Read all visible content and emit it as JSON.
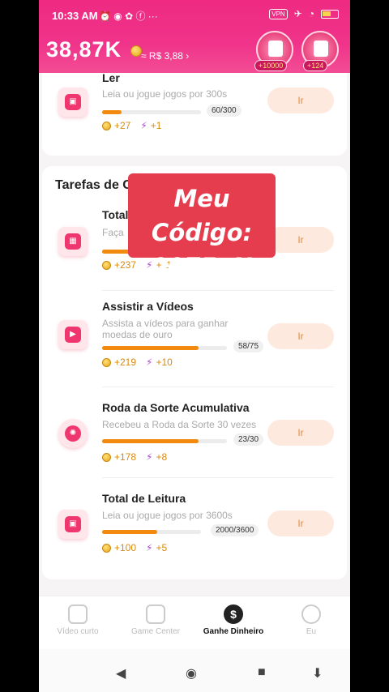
{
  "status": {
    "time": "10:33 AM",
    "left_icons": "⏰ ◉ ✿ ⓕ ···",
    "vpn": "VPN"
  },
  "header": {
    "balance": "38,87K",
    "balance_sub": "≈ R$ 3,88 ›",
    "bonus1": "+10000",
    "bonus2": "+124"
  },
  "tasks_top": {
    "title": "Ler",
    "desc": "Leia ou jogue jogos por 300s",
    "progress": "60/300",
    "progress_fraction": 0.2,
    "coins": "+27",
    "energy": "+1",
    "button": "Ir"
  },
  "section": {
    "title": "Tarefas de C"
  },
  "overlay": {
    "line1": "Meu Código:",
    "line2": "0075oN"
  },
  "tasks": [
    {
      "title": "Total",
      "desc": "Faça",
      "progress": "",
      "progress_fraction": 0.35,
      "coins": "+237",
      "energy": "+11",
      "button": "Ir",
      "icon": "calendar-icon"
    },
    {
      "title": "Assistir a Vídeos",
      "desc": "Assista a vídeos para ganhar moedas de ouro",
      "progress": "58/75",
      "progress_fraction": 0.77,
      "coins": "+219",
      "energy": "+10",
      "button": "Ir",
      "icon": "video-icon"
    },
    {
      "title": "Roda da Sorte Acumulativa",
      "desc": "Recebeu a Roda da Sorte 30 vezes",
      "progress": "23/30",
      "progress_fraction": 0.77,
      "coins": "+178",
      "energy": "+8",
      "button": "Ir",
      "icon": "wheel-icon"
    },
    {
      "title": "Total de Leitura",
      "desc": "Leia ou jogue jogos por 3600s",
      "progress": "2000/3600",
      "progress_fraction": 0.56,
      "coins": "+100",
      "energy": "+5",
      "button": "Ir",
      "icon": "book-icon"
    }
  ],
  "tabs": [
    {
      "label": "Vídeo curto"
    },
    {
      "label": "Game Center"
    },
    {
      "label": "Ganhe Dinheiro"
    },
    {
      "label": "Eu"
    }
  ],
  "colors": {
    "brand": "#ee2a82",
    "accent_orange": "#f28a10",
    "button_bg": "#fde9de"
  }
}
